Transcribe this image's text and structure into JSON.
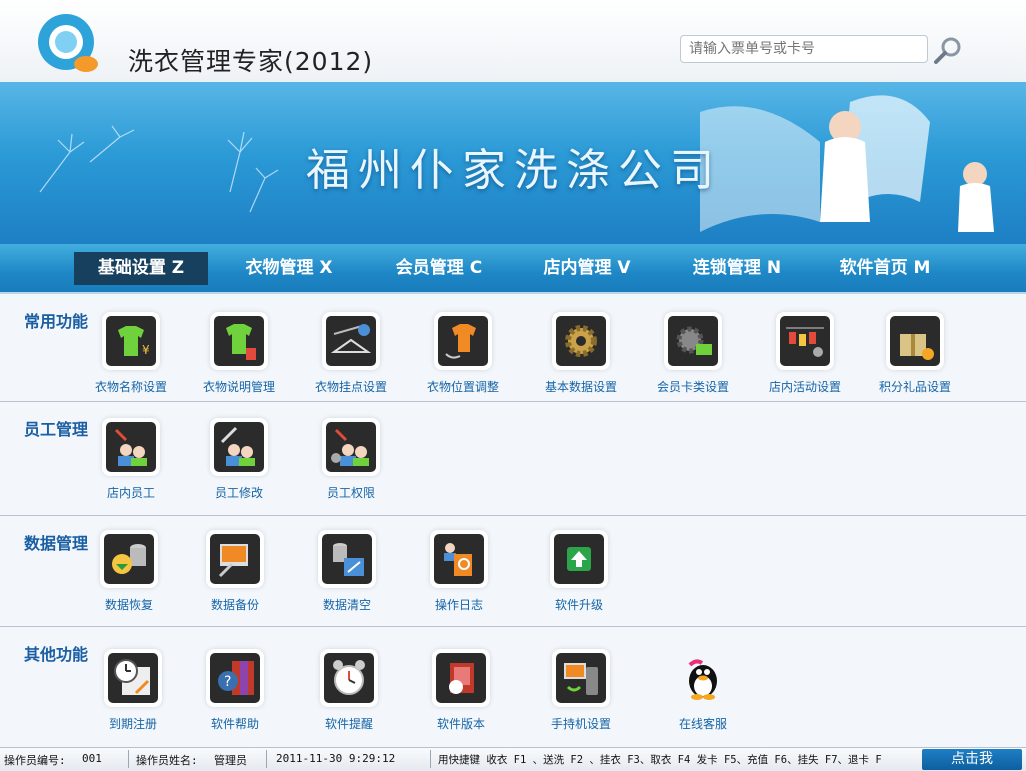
{
  "header": {
    "app_title": "洗衣管理专家(2012)",
    "search_placeholder": "请输入票单号或卡号"
  },
  "banner": {
    "company_name": "福州仆家洗涤公司"
  },
  "nav": [
    {
      "label": "基础设置 Z",
      "active": true
    },
    {
      "label": "衣物管理 X"
    },
    {
      "label": "会员管理 C"
    },
    {
      "label": "店内管理 V"
    },
    {
      "label": "连锁管理 N"
    },
    {
      "label": "软件首页 M"
    }
  ],
  "sections": [
    {
      "title": "常用功能",
      "items": [
        {
          "label": "衣物名称设置",
          "icon": "shirt-price-icon"
        },
        {
          "label": "衣物说明管理",
          "icon": "shirt-note-icon"
        },
        {
          "label": "衣物挂点设置",
          "icon": "hanger-gear-icon"
        },
        {
          "label": "衣物位置调整",
          "icon": "shirt-move-icon"
        },
        {
          "label": "基本数据设置",
          "icon": "gear-icon"
        },
        {
          "label": "会员卡类设置",
          "icon": "card-gear-icon"
        },
        {
          "label": "店内活动设置",
          "icon": "activity-tags-icon"
        },
        {
          "label": "积分礼品设置",
          "icon": "gift-icon"
        }
      ]
    },
    {
      "title": "员工管理",
      "items": [
        {
          "label": "店内员工",
          "icon": "staff-icon"
        },
        {
          "label": "员工修改",
          "icon": "staff-edit-icon"
        },
        {
          "label": "员工权限",
          "icon": "staff-permission-icon"
        }
      ]
    },
    {
      "title": "数据管理",
      "items": [
        {
          "label": "数据恢复",
          "icon": "database-restore-icon"
        },
        {
          "label": "数据备份",
          "icon": "backup-icon"
        },
        {
          "label": "数据清空",
          "icon": "clear-data-icon"
        },
        {
          "label": "操作日志",
          "icon": "log-icon"
        },
        {
          "label": "软件升级",
          "icon": "upgrade-icon"
        }
      ]
    },
    {
      "title": "其他功能",
      "items": [
        {
          "label": "到期注册",
          "icon": "clock-register-icon"
        },
        {
          "label": "软件帮助",
          "icon": "help-book-icon"
        },
        {
          "label": "软件提醒",
          "icon": "alarm-clock-icon"
        },
        {
          "label": "软件版本",
          "icon": "version-icon"
        },
        {
          "label": "手持机设置",
          "icon": "handheld-icon"
        },
        {
          "label": "在线客服",
          "icon": "qq-penguin-icon"
        }
      ]
    }
  ],
  "status": {
    "operator_id_label": "操作员编号:",
    "operator_id": "001",
    "operator_name_label": "操作员姓名:",
    "operator_name": "管理员",
    "datetime": "2011-11-30 9:29:12",
    "shortcuts": "用快捷键 收衣 F1 、送洗 F2 、挂衣 F3、取衣 F4  发卡 F5、充值 F6、挂失 F7、退卡 F",
    "click_me": "点击我"
  },
  "colors": {
    "accent": "#1a5fa3",
    "nav_bg": "#1e87c6",
    "nav_active": "#17405f"
  }
}
